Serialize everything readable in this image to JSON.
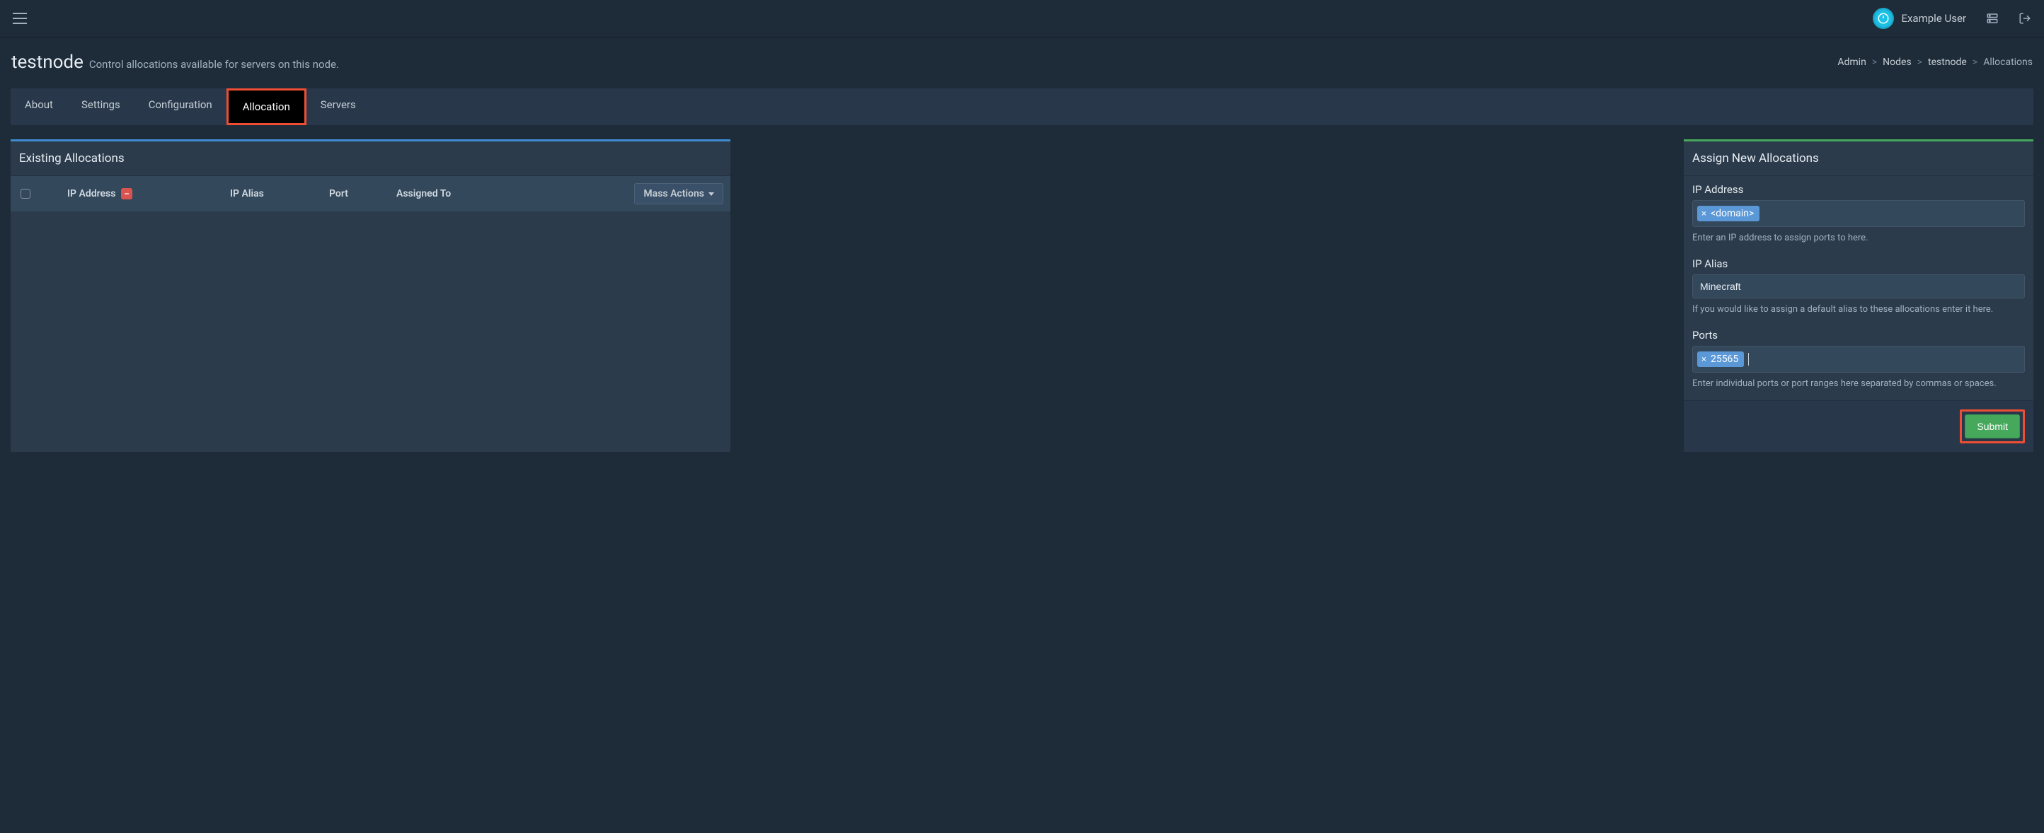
{
  "header": {
    "user_name": "Example User"
  },
  "page": {
    "title": "testnode",
    "subtitle": "Control allocations available for servers on this node."
  },
  "breadcrumb": {
    "items": [
      "Admin",
      "Nodes",
      "testnode",
      "Allocations"
    ]
  },
  "tabs": {
    "items": [
      "About",
      "Settings",
      "Configuration",
      "Allocation",
      "Servers"
    ],
    "active_index": 3
  },
  "existing_panel": {
    "title": "Existing Allocations",
    "columns": {
      "ip": "IP Address",
      "alias": "IP Alias",
      "port": "Port",
      "assigned": "Assigned To"
    },
    "mass_actions_label": "Mass Actions"
  },
  "assign_panel": {
    "title": "Assign New Allocations",
    "ip_label": "IP Address",
    "ip_tags": [
      "<domain>"
    ],
    "ip_help": "Enter an IP address to assign ports to here.",
    "alias_label": "IP Alias",
    "alias_value": "Minecraft",
    "alias_help": "If you would like to assign a default alias to these allocations enter it here.",
    "ports_label": "Ports",
    "ports_tags": [
      "25565"
    ],
    "ports_help": "Enter individual ports or port ranges here separated by commas or spaces.",
    "submit_label": "Submit"
  }
}
